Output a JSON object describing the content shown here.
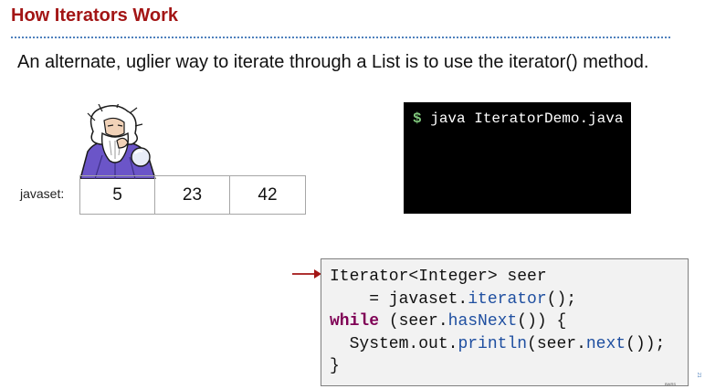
{
  "slide": {
    "title": "How Iterators Work",
    "body_text": "An alternate, uglier way to iterate through a List is to use the iterator() method.",
    "page_number": "21"
  },
  "array": {
    "label": "javaset:",
    "cells": [
      "5",
      "23",
      "42"
    ]
  },
  "terminal": {
    "prompt": "$",
    "command": " java IteratorDemo.java"
  },
  "code": {
    "line1": "Iterator<Integer> seer",
    "line2_prefix": "    = javaset.",
    "line2_method": "iterator",
    "line2_suffix": "();",
    "line3_keyword": "while",
    "line3_mid": " (seer.",
    "line3_method": "hasNext",
    "line3_suffix": "()) {",
    "line4_prefix": "  System.out.",
    "line4_method1": "println",
    "line4_mid": "(seer.",
    "line4_method2": "next",
    "line4_suffix": "());",
    "line5": "}"
  },
  "footer": {
    "tag": "BWRS"
  },
  "colors": {
    "title": "#a31515",
    "rule": "#4f81bd",
    "terminal_bg": "#000000",
    "prompt": "#7fc77b",
    "keyword": "#7f0055",
    "method": "#1f4fa0",
    "arrow": "#a31515"
  },
  "icons": {
    "wizard": "wizard-illustration",
    "arrow": "pointer-arrow-icon"
  }
}
